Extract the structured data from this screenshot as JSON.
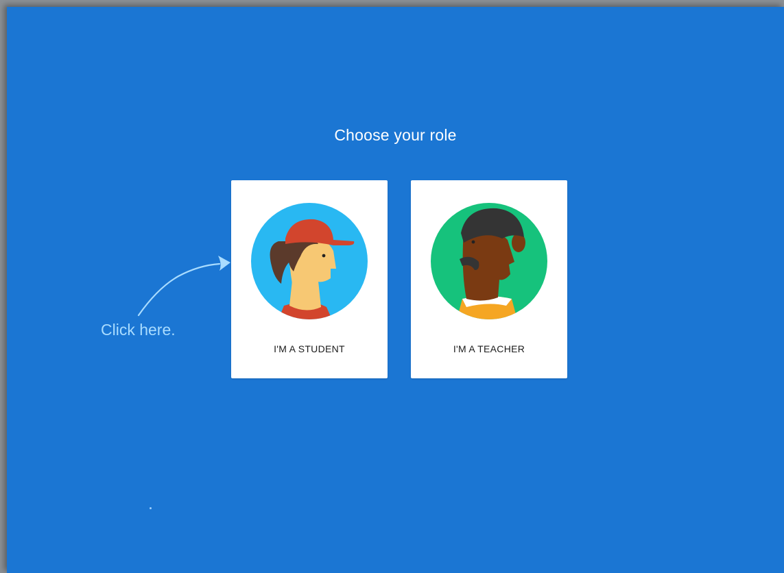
{
  "page": {
    "title": "Choose your role"
  },
  "roles": [
    {
      "label": "I'M A STUDENT",
      "avatar_icon": "student-avatar-icon"
    },
    {
      "label": "I'M A TEACHER",
      "avatar_icon": "teacher-avatar-icon"
    }
  ],
  "annotation": {
    "text": "Click here.",
    "color": "#a9dcff"
  },
  "colors": {
    "background": "#1b76d3",
    "card": "#ffffff",
    "student_circle": "#29b8f2",
    "teacher_circle": "#16c27c"
  }
}
